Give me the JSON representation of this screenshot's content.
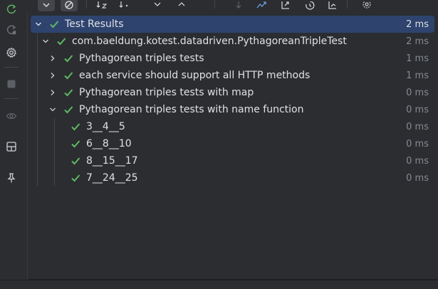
{
  "tree": {
    "rows": [
      {
        "label": "Test Results",
        "duration": "2 ms"
      },
      {
        "label": "com.baeldung.kotest.datadriven.PythagoreanTripleTest",
        "duration": "2 ms"
      },
      {
        "label": "Pythagorean triples tests",
        "duration": "1 ms"
      },
      {
        "label": "each service should support all HTTP methods",
        "duration": "1 ms"
      },
      {
        "label": "Pythagorean triples tests with map",
        "duration": "0 ms"
      },
      {
        "label": "Pythagorean triples tests with name function",
        "duration": "0 ms"
      },
      {
        "label": "3__4__5",
        "duration": "0 ms"
      },
      {
        "label": "6__8__10",
        "duration": "0 ms"
      },
      {
        "label": "8__15__17",
        "duration": "0 ms"
      },
      {
        "label": "7__24__25",
        "duration": "0 ms"
      }
    ]
  },
  "colors": {
    "background": "#2b2d30",
    "selection": "#2e436e",
    "pass_green": "#5fb865",
    "text": "#dfe1e5",
    "muted": "#868a91"
  }
}
